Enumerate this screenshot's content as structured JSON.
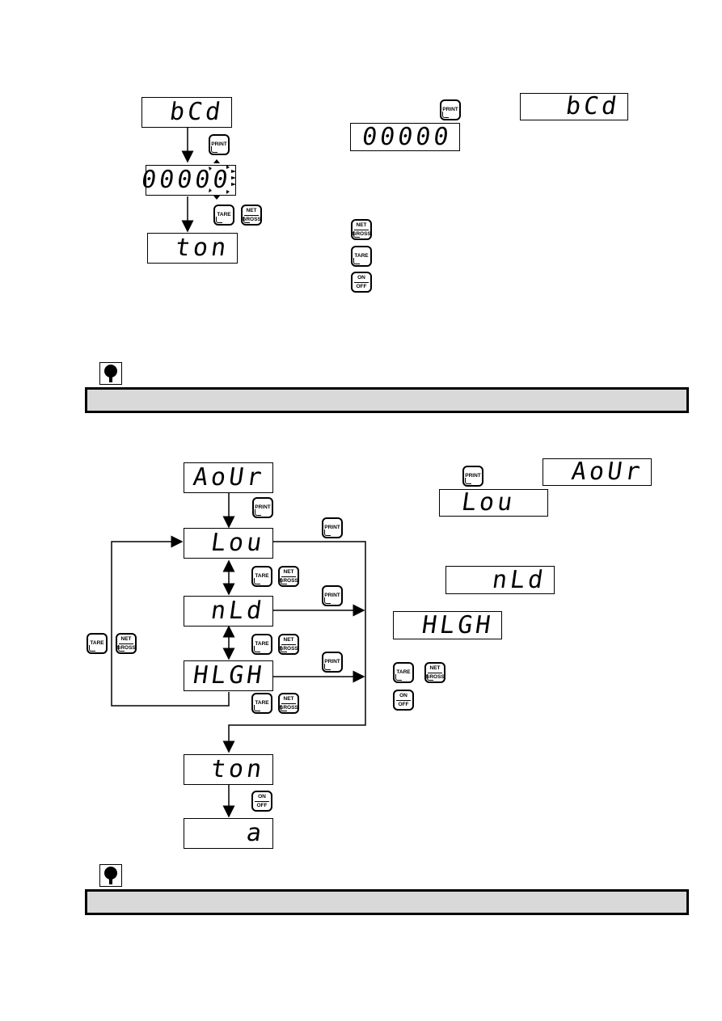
{
  "section1": {
    "flow": {
      "display_1": "bCd",
      "key_1": "PRINT",
      "display_2": "00000",
      "keys_2": [
        "TARE",
        "NET/GROSS"
      ],
      "display_3": "ton"
    },
    "description": {
      "print_key": "PRINT",
      "display_value": "00000",
      "display_bcd": "bCd",
      "key_list": [
        "NET/GROSS",
        "TARE",
        "ON/OFF"
      ]
    },
    "note_text": ""
  },
  "section2": {
    "flow": {
      "display_avr": "AoUr",
      "key_print": "PRINT",
      "display_low": "Lou",
      "display_mid": "nLd",
      "display_high": "HLGH",
      "display_ton": "ton",
      "display_end": "a",
      "key_on_off": "ON/OFF",
      "cycle_keys": [
        "TARE",
        "NET/GROSS"
      ]
    },
    "description": {
      "print_key": "PRINT",
      "display_avr": "AoUr",
      "display_low": "Lou",
      "display_mid": "nLd",
      "display_high": "HLGH",
      "key_list": [
        "TARE",
        "NET/GROSS",
        "ON/OFF"
      ]
    },
    "note_text": ""
  },
  "keys": {
    "print": "PRINT",
    "tare": "TARE",
    "net": "NET",
    "gross": "GROSS",
    "on": "ON",
    "off": "OFF"
  }
}
